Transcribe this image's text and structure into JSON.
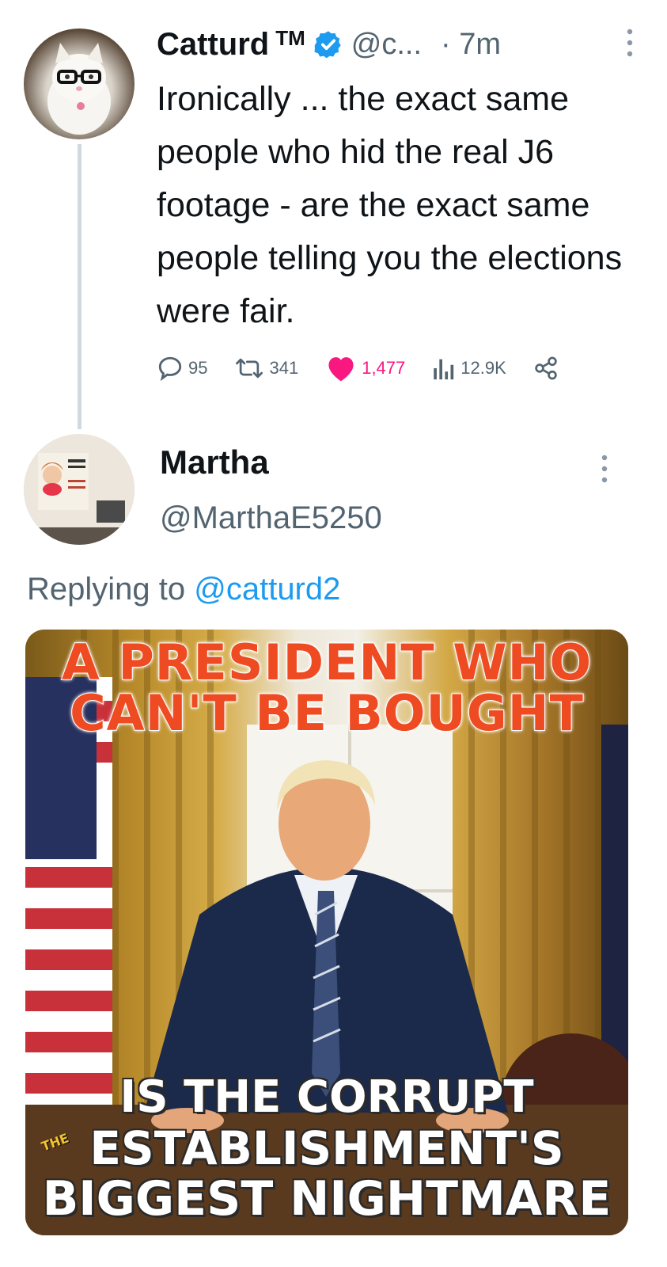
{
  "tweet1": {
    "name": "Catturd",
    "tm": "TM",
    "handle": "@c...",
    "time": "· 7m",
    "text": "Ironically ... the exact same people who hid the real J6 footage - are the exact same people telling you the elections were fair.",
    "replies": "95",
    "retweets": "341",
    "likes": "1,477",
    "views": "12.9K"
  },
  "tweet2": {
    "name": "Martha",
    "handle": "@MarthaE5250",
    "replying_prefix": "Replying to ",
    "replying_mention": "@catturd2",
    "image": {
      "headline_line1": "A PRESIDENT WHO",
      "headline_line2": "CAN'T BE BOUGHT",
      "bottom_line1": "IS THE CORRUPT",
      "bottom_line2": "ESTABLISHMENT'S",
      "bottom_line3": "BIGGEST NIGHTMARE",
      "watermark": "THE"
    }
  },
  "colors": {
    "text_primary": "#0f1419",
    "text_secondary": "#536471",
    "accent_blue": "#1d9bf0",
    "like_pink": "#f91880",
    "headline_orange": "#ef4b23"
  },
  "icons": {
    "verified": "verified-badge-icon",
    "reply": "reply-bubble-icon",
    "retweet": "retweet-icon",
    "like": "heart-icon",
    "views": "views-bars-icon",
    "share": "share-icon",
    "more": "more-vertical-icon"
  }
}
